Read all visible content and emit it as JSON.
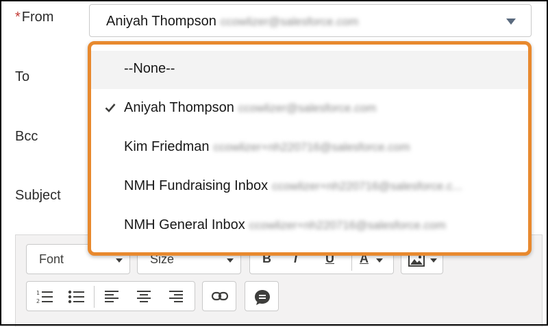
{
  "form": {
    "from_label": "From",
    "to_label": "To",
    "bcc_label": "Bcc",
    "subject_label": "Subject",
    "from_value_name": "Aniyah Thompson",
    "from_value_email": "ccowlizer@salesforce.com"
  },
  "dropdown": {
    "options": [
      {
        "name": "--None--",
        "email": "",
        "selected": false
      },
      {
        "name": "Aniyah Thompson",
        "email": "ccowlizer@salesforce.com",
        "selected": true
      },
      {
        "name": "Kim Friedman",
        "email": "ccowlizer+nh220716@salesforce.com",
        "selected": false
      },
      {
        "name": "NMH Fundraising Inbox",
        "email": "ccowlizer+nh220716@salesforce.c...",
        "selected": false
      },
      {
        "name": "NMH General Inbox",
        "email": "ccowlizer+nh220716@salesforce.com",
        "selected": false
      }
    ]
  },
  "toolbar": {
    "font_label": "Font",
    "size_label": "Size",
    "bold_label": "B",
    "italic_label": "I",
    "underline_label": "U",
    "text_color_label": "A"
  },
  "colors": {
    "highlight": "#e8892e",
    "required": "#c23934"
  }
}
